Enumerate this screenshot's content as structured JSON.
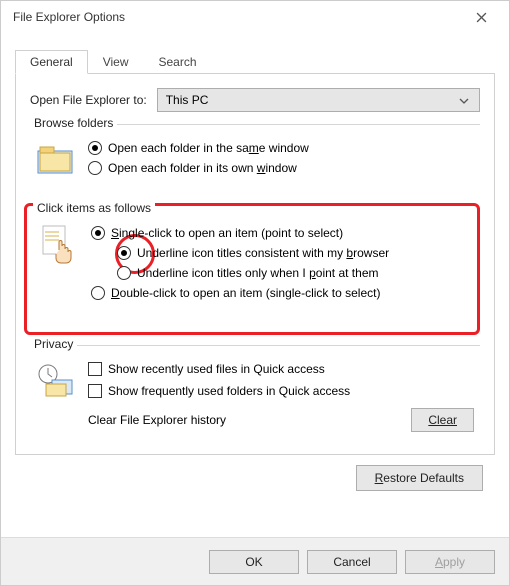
{
  "window": {
    "title": "File Explorer Options"
  },
  "tabs": {
    "general": "General",
    "view": "View",
    "search": "Search"
  },
  "open_to": {
    "label": "Open File Explorer to:",
    "value": "This PC"
  },
  "browse": {
    "legend": "Browse folders",
    "same": "Open each folder in the same window",
    "own": "Open each folder in its own window"
  },
  "click": {
    "legend": "Click items as follows",
    "single": "Single-click to open an item (point to select)",
    "und_browser": "Underline icon titles consistent with my browser",
    "und_point": "Underline icon titles only when I point at them",
    "double": "Double-click to open an item (single-click to select)"
  },
  "privacy": {
    "legend": "Privacy",
    "recent_files": "Show recently used files in Quick access",
    "frequent_folders": "Show frequently used folders in Quick access",
    "clear_label": "Clear File Explorer history",
    "clear_btn": "Clear"
  },
  "buttons": {
    "restore": "Restore Defaults",
    "ok": "OK",
    "cancel": "Cancel",
    "apply": "Apply"
  }
}
